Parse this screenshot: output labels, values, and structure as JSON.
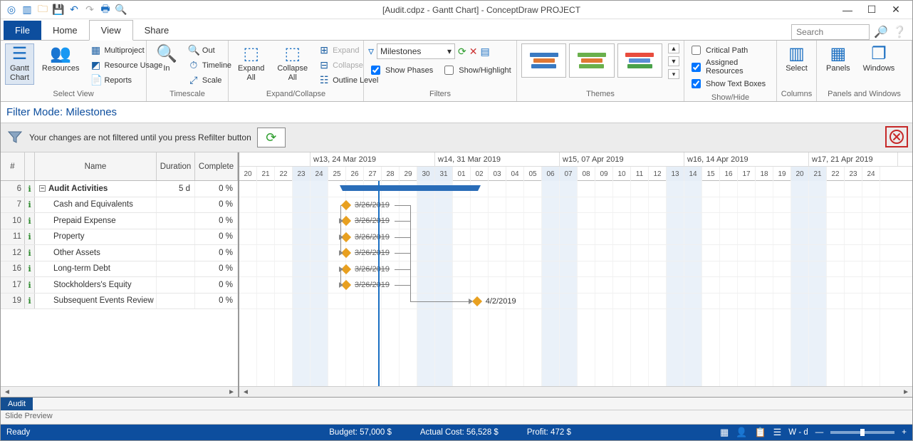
{
  "title": "[Audit.cdpz - Gantt Chart] - ConceptDraw PROJECT",
  "menu": {
    "file": "File",
    "tabs": [
      "Home",
      "View",
      "Share"
    ],
    "active": "View"
  },
  "search": {
    "placeholder": "Search"
  },
  "ribbon": {
    "select_view": {
      "title": "Select View",
      "gantt": "Gantt\nChart",
      "resources": "Resources",
      "multiproject": "Multiproject",
      "resource_usage": "Resource Usage",
      "reports": "Reports"
    },
    "timescale": {
      "title": "Timescale",
      "in": "In",
      "out": "Out",
      "timeline": "Timeline",
      "scale": "Scale"
    },
    "expand": {
      "title": "Expand/Collapse",
      "expand_all": "Expand\nAll",
      "collapse_all": "Collapse\nAll",
      "expand": "Expand",
      "collapse": "Collapse",
      "outline": "Outline Level"
    },
    "filters": {
      "title": "Filters",
      "selected": "Milestones",
      "show_phases": "Show Phases",
      "show_highlight": "Show/Highlight"
    },
    "themes": {
      "title": "Themes"
    },
    "showhide": {
      "title": "Show/Hide",
      "critical": "Critical Path",
      "assigned": "Assigned Resources",
      "textboxes": "Show Text Boxes",
      "checked": {
        "critical": false,
        "assigned": true,
        "textboxes": true
      }
    },
    "columns": {
      "title": "Columns",
      "select": "Select"
    },
    "panels": {
      "title": "Panels and Windows",
      "panels": "Panels",
      "windows": "Windows"
    }
  },
  "filter_mode": "Filter Mode: Milestones",
  "refilter_msg": "Your changes are not filtered until you press Refilter button",
  "grid": {
    "headers": {
      "num": "#",
      "name": "Name",
      "duration": "Duration",
      "complete": "Complete"
    },
    "rows": [
      {
        "num": 6,
        "name": "Audit Activities",
        "duration": "5 d",
        "complete": "0 %",
        "summary": true
      },
      {
        "num": 7,
        "name": "Cash and Equivalents",
        "duration": "",
        "complete": "0 %"
      },
      {
        "num": 10,
        "name": "Prepaid Expense",
        "duration": "",
        "complete": "0 %"
      },
      {
        "num": 11,
        "name": "Property",
        "duration": "",
        "complete": "0 %"
      },
      {
        "num": 12,
        "name": "Other Assets",
        "duration": "",
        "complete": "0 %"
      },
      {
        "num": 16,
        "name": "Long-term Debt",
        "duration": "",
        "complete": "0 %"
      },
      {
        "num": 17,
        "name": "Stockholders's Equity",
        "duration": "",
        "complete": "0 %"
      },
      {
        "num": 19,
        "name": "Subsequent Events Review",
        "duration": "",
        "complete": "0 %"
      }
    ]
  },
  "timeline": {
    "weeks": [
      {
        "label": "",
        "days": 4
      },
      {
        "label": "w13, 24 Mar 2019",
        "days": 7
      },
      {
        "label": "w14, 31 Mar 2019",
        "days": 7
      },
      {
        "label": "w15, 07 Apr 2019",
        "days": 7
      },
      {
        "label": "w16, 14 Apr 2019",
        "days": 7
      },
      {
        "label": "w17, 21 Apr 2019",
        "days": 5
      }
    ],
    "days": [
      20,
      21,
      22,
      23,
      24,
      25,
      26,
      27,
      28,
      29,
      30,
      31,
      "01",
      "02",
      "03",
      "04",
      "05",
      "06",
      "07",
      "08",
      "09",
      10,
      11,
      12,
      13,
      14,
      15,
      16,
      17,
      18,
      19,
      20,
      21,
      22,
      23,
      24
    ],
    "weekend_idx": [
      3,
      4,
      10,
      11,
      17,
      18,
      24,
      25,
      31,
      32
    ],
    "today_idx": 7.8,
    "milestones": {
      "summary": {
        "start": 5.8,
        "end": 13.4
      },
      "items": [
        {
          "row": 1,
          "day": 6,
          "label": "3/26/2019",
          "strike": true
        },
        {
          "row": 2,
          "day": 6,
          "label": "3/26/2019",
          "strike": true
        },
        {
          "row": 3,
          "day": 6,
          "label": "3/26/2019",
          "strike": true
        },
        {
          "row": 4,
          "day": 6,
          "label": "3/26/2019",
          "strike": true
        },
        {
          "row": 5,
          "day": 6,
          "label": "3/26/2019",
          "strike": true
        },
        {
          "row": 6,
          "day": 6,
          "label": "3/26/2019",
          "strike": true
        },
        {
          "row": 7,
          "day": 13.35,
          "label": "4/2/2019",
          "strike": false
        }
      ]
    }
  },
  "sheet_tab": "Audit",
  "slide_preview": "Slide Preview",
  "status": {
    "ready": "Ready",
    "budget": "Budget: 57,000 $",
    "actual": "Actual Cost: 56,528 $",
    "profit": "Profit: 472 $",
    "wd": "W - d"
  }
}
